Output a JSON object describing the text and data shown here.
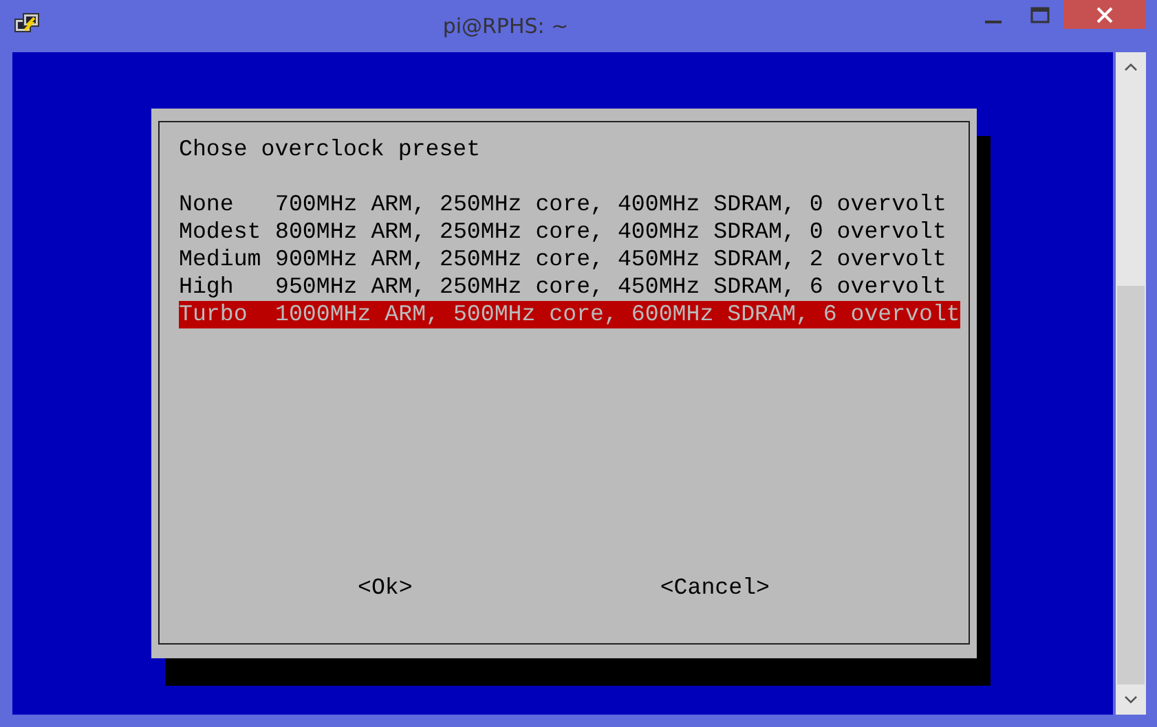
{
  "window": {
    "title": "pi@RPHS: ~"
  },
  "dialog": {
    "title": "Chose overclock preset",
    "options": [
      {
        "name": "None",
        "description": "700MHz ARM, 250MHz core, 400MHz SDRAM, 0 overvolt",
        "selected": false
      },
      {
        "name": "Modest",
        "description": "800MHz ARM, 250MHz core, 400MHz SDRAM, 0 overvolt",
        "selected": false
      },
      {
        "name": "Medium",
        "description": "900MHz ARM, 250MHz core, 450MHz SDRAM, 2 overvolt",
        "selected": false
      },
      {
        "name": "High",
        "description": "950MHz ARM, 250MHz core, 450MHz SDRAM, 6 overvolt",
        "selected": false
      },
      {
        "name": "Turbo",
        "description": "1000MHz ARM, 500MHz core, 600MHz SDRAM, 6 overvolt",
        "selected": true
      }
    ],
    "buttons": [
      "<Ok>",
      "<Cancel>"
    ]
  }
}
